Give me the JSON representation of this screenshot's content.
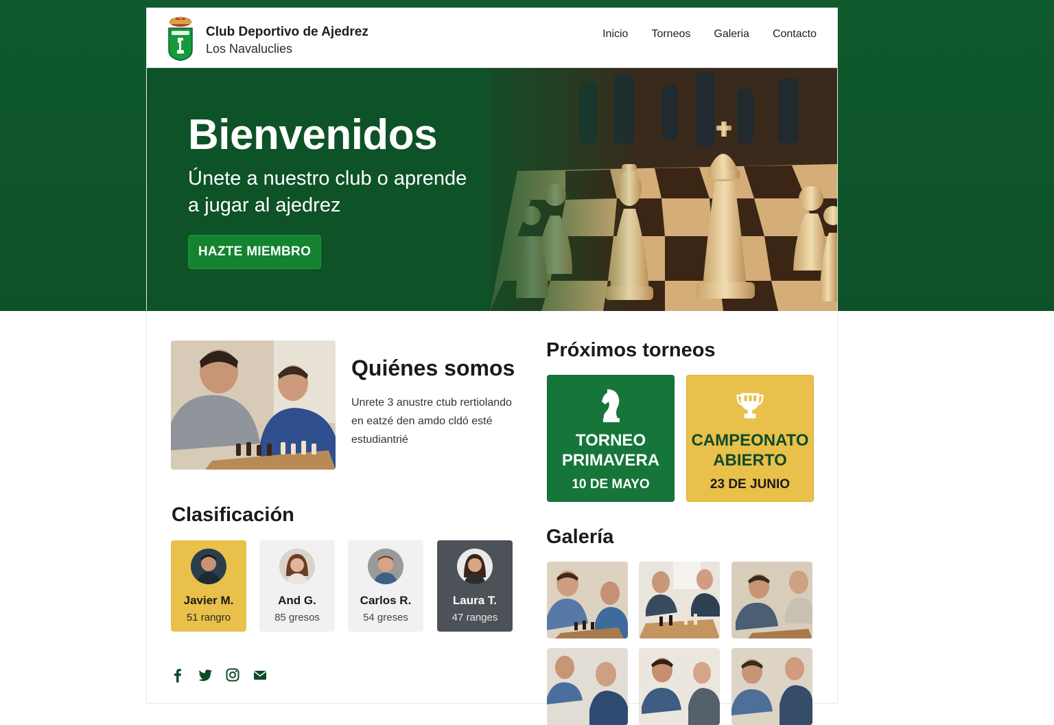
{
  "brand": {
    "title": "Club Deportivo de Ajedrez",
    "subtitle": "Los Navaluclies"
  },
  "nav": {
    "items": [
      "Inicio",
      "Torneos",
      "Galeria",
      "Contacto"
    ]
  },
  "hero": {
    "title": "Bienvenidos",
    "subtitle": "Únete a nuestro club o aprende a jugar al ajedrez",
    "button": "HAZTE MIEMBRO"
  },
  "about": {
    "title": "Quiénes somos",
    "text": "Unrete 3 anustre ctub rertiolando en eatzé den amdo cldó esté estudiantrié"
  },
  "ranking": {
    "title": "Clasificación",
    "players": [
      {
        "name": "Javier M.",
        "score": "51 rangro"
      },
      {
        "name": "And G.",
        "score": "85 gresos"
      },
      {
        "name": "Carlos R.",
        "score": "54 greses"
      },
      {
        "name": "Laura T.",
        "score": "47 ranges"
      }
    ]
  },
  "tournaments": {
    "title": "Próximos torneos",
    "items": [
      {
        "name": "TORNEO PRIMAVERA",
        "date": "10 DE MAYO",
        "color": "#16763a"
      },
      {
        "name": "CAMPEONATO ABIERTO",
        "date": "23 DE JUNIO",
        "color": "#e9c04a"
      }
    ]
  },
  "gallery": {
    "title": "Galería"
  },
  "social": [
    "facebook-icon",
    "twitter-icon",
    "instagram-icon",
    "mail-icon"
  ],
  "colors": {
    "primary_green": "#0e5228",
    "button_green": "#14832f",
    "gold": "#e9c04a",
    "dark_card": "#4c5257"
  }
}
